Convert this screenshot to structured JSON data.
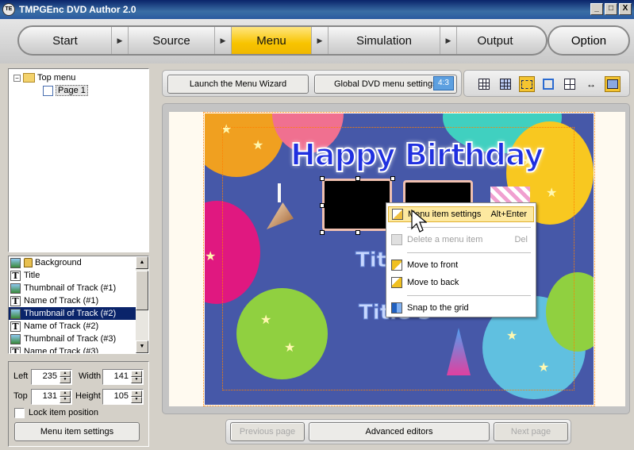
{
  "window": {
    "title": "TMPGEnc DVD Author 2.0",
    "icon_text": "TE",
    "minimize": "_",
    "maximize": "□",
    "close": "X"
  },
  "nav": {
    "tabs": [
      {
        "label": "Start"
      },
      {
        "label": "Source"
      },
      {
        "label": "Menu"
      },
      {
        "label": "Simulation"
      },
      {
        "label": "Output"
      }
    ],
    "arrow": "▶",
    "active_tab": "Menu",
    "option_label": "Option"
  },
  "tree": {
    "expander": "−",
    "root": "Top menu",
    "child": "Page 1"
  },
  "items_list": [
    {
      "label": "Background",
      "icon": "image",
      "locked": true
    },
    {
      "label": "Title",
      "icon": "text"
    },
    {
      "label": "Thumbnail of Track (#1)",
      "icon": "image"
    },
    {
      "label": "Name of Track (#1)",
      "icon": "text"
    },
    {
      "label": "Thumbnail of Track (#2)",
      "icon": "image",
      "selected": true
    },
    {
      "label": "Name of Track (#2)",
      "icon": "text"
    },
    {
      "label": "Thumbnail of Track (#3)",
      "icon": "image"
    },
    {
      "label": "Name of Track (#3)",
      "icon": "text"
    }
  ],
  "text_icon_glyph": "T",
  "scroll_up": "▲",
  "scroll_down": "▼",
  "props": {
    "left_label": "Left",
    "left_value": "235",
    "width_label": "Width",
    "width_value": "141",
    "top_label": "Top",
    "top_value": "131",
    "height_label": "Height",
    "height_value": "105",
    "lock_label": "Lock item position",
    "settings_button": "Menu item settings",
    "spin_up": "▲",
    "spin_down": "▼"
  },
  "toolbar": {
    "wizard_button": "Launch the Menu Wizard",
    "global_settings_button": "Global DVD menu settings",
    "aspect_badge": "4:3"
  },
  "canvas": {
    "title": "Happy Birthday",
    "name_track_2": "Title 2",
    "name_track_3": "Title 3",
    "colors": {
      "background": "#4658a8",
      "title": "#2030e0",
      "selection": "#ff8000"
    }
  },
  "context_menu": {
    "items": [
      {
        "label": "Menu item settings",
        "shortcut": "Alt+Enter",
        "state": "highlighted",
        "icon": "edit-icon"
      },
      {
        "label": "Delete a menu item",
        "shortcut": "Del",
        "state": "disabled",
        "icon": "eraser-icon"
      },
      {
        "label": "Move to front",
        "shortcut": "",
        "state": "normal",
        "icon": "bring-front-icon"
      },
      {
        "label": "Move to back",
        "shortcut": "",
        "state": "normal",
        "icon": "send-back-icon"
      },
      {
        "label": "Snap to the grid",
        "shortcut": "",
        "state": "normal",
        "icon": "snap-grid-icon"
      }
    ]
  },
  "bottom": {
    "prev_page": "Previous page",
    "advanced_editors": "Advanced editors",
    "next_page": "Next page"
  }
}
